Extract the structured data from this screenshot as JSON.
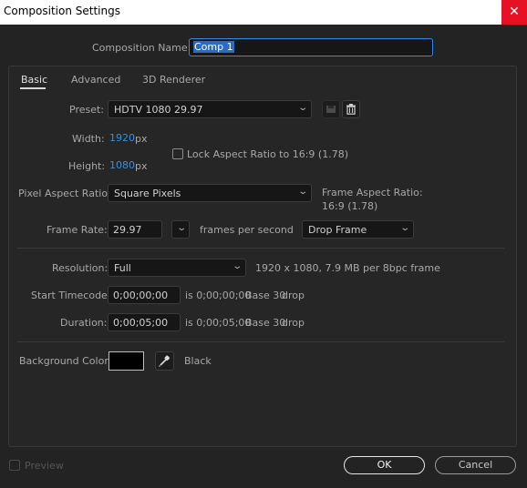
{
  "window": {
    "title": "Composition Settings",
    "close_icon": "close-icon"
  },
  "comp_name": {
    "label": "Composition Name:",
    "value": "Comp 1"
  },
  "tabs": [
    {
      "label": "Basic",
      "active": true
    },
    {
      "label": "Advanced",
      "active": false
    },
    {
      "label": "3D Renderer",
      "active": false
    }
  ],
  "preset": {
    "label": "Preset:",
    "value": "HDTV 1080 29.97"
  },
  "width": {
    "label": "Width:",
    "value": "1920",
    "unit": "px"
  },
  "height": {
    "label": "Height:",
    "value": "1080",
    "unit": "px"
  },
  "lock_aspect": {
    "label": "Lock Aspect Ratio to 16:9 (1.78)",
    "checked": false
  },
  "pixel_aspect": {
    "label": "Pixel Aspect Ratio:",
    "value": "Square Pixels"
  },
  "frame_aspect": {
    "label": "Frame Aspect Ratio:",
    "value": "16:9 (1.78)"
  },
  "frame_rate": {
    "label": "Frame Rate:",
    "value": "29.97",
    "unit": "frames per second",
    "drop_frame": "Drop Frame"
  },
  "resolution": {
    "label": "Resolution:",
    "value": "Full",
    "info": "1920 x 1080, 7.9 MB per 8bpc frame"
  },
  "start_timecode": {
    "label": "Start Timecode:",
    "value": "0;00;00;00",
    "info_is": "is 0;00;00;00",
    "base": "Base 30",
    "drop": "drop"
  },
  "duration": {
    "label": "Duration:",
    "value": "0;00;05;00",
    "info_is": "is 0;00;05;00",
    "base": "Base 30",
    "drop": "drop"
  },
  "background": {
    "label": "Background Color:",
    "color": "#000000",
    "name": "Black"
  },
  "footer": {
    "preview_label": "Preview",
    "ok_label": "OK",
    "cancel_label": "Cancel"
  },
  "colors": {
    "accent_blue": "#3a8fdb",
    "close_red": "#e81123",
    "selection": "#2b6bc2"
  }
}
